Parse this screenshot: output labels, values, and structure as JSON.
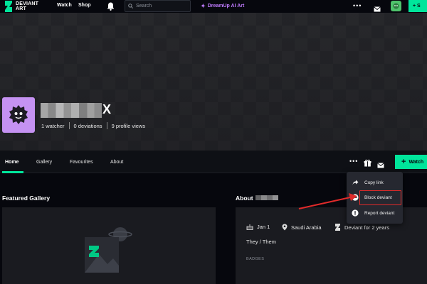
{
  "topnav": {
    "logo_line1": "DEVIANT",
    "logo_line2": "ART",
    "watch_label": "Watch",
    "shop_label": "Shop",
    "search_placeholder": "Search",
    "dreamup_label": "DreamUp AI Art",
    "more_label": "•••",
    "submit_label": "+ S",
    "icons": [
      "bell-icon",
      "search-icon",
      "sparkle-icon",
      "more-icon",
      "mail-icon",
      "avatar"
    ]
  },
  "profile": {
    "username_suffix": "X",
    "watchers": "1 watcher",
    "deviations": "0 deviations",
    "profile_views": "9 profile views"
  },
  "tabs": [
    {
      "label": "Home",
      "active": true
    },
    {
      "label": "Gallery",
      "active": false
    },
    {
      "label": "Favourites",
      "active": false
    },
    {
      "label": "About",
      "active": false
    }
  ],
  "actions": {
    "more_label": "•••",
    "watch_label": "Watch"
  },
  "featured": {
    "title": "Featured Gallery"
  },
  "about": {
    "title": "About",
    "joined": "Jan 1",
    "location": "Saudi Arabia",
    "deviant_for": "Deviant for 2 years",
    "pronouns": "They / Them",
    "badges_label": "BADGES"
  },
  "menu": {
    "items": [
      {
        "label": "Copy link",
        "icon": "share-icon"
      },
      {
        "label": "Block deviant",
        "icon": "block-icon"
      },
      {
        "label": "Report deviant",
        "icon": "report-icon"
      }
    ]
  },
  "colors": {
    "accent": "#00e59b",
    "background": "#06070d",
    "avatar_bg": "#c592f2",
    "dreamup": "#c07cff",
    "annotation": "#e02a2a"
  }
}
